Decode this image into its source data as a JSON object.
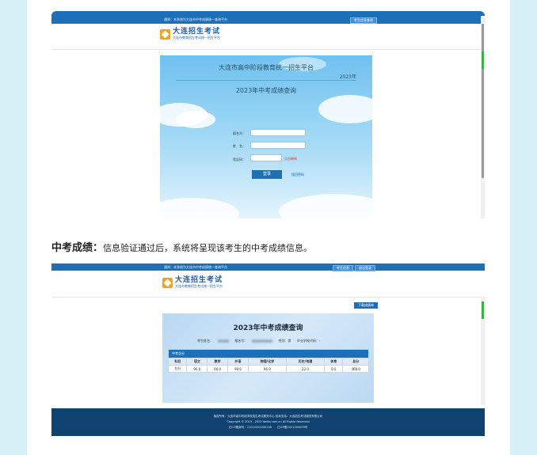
{
  "shot1": {
    "notice": "通知：本系统为大连市中考成绩统一查询平台",
    "top_button": "考生信息查询",
    "logo_title": "大连招生考试",
    "logo_subtitle": "大连市教育招生考试统一招生平台",
    "platform_title": "大连市高中阶段教育统一招生平台",
    "year": "2023年",
    "query_title": "2023年中考成绩查询",
    "form": {
      "exam_no_label": "报名号：",
      "name_label": "姓　名：",
      "captcha_label": "验证码：",
      "captcha_hint": "点击刷新",
      "login_button": "登录",
      "forgot_link": "找回密码"
    }
  },
  "caption": {
    "heading": "中考成绩：",
    "text": "信息验证通过后，系统将呈现该考生的中考成绩信息。"
  },
  "shot2": {
    "notice": "通知：本系统为大连市中考成绩统一查询平台",
    "top_buttons": [
      "考生信息",
      "退出登录"
    ],
    "logo_title": "大连招生考试",
    "logo_subtitle": "大连市教育招生考试统一招生平台",
    "download_button": "下载成绩单",
    "result_title": "2023年中考成绩查询",
    "info": {
      "name_label": "考生姓名：",
      "exam_no_label": "报名号：",
      "gender_label": "性别：男",
      "school_label": "毕业学校代码：-"
    },
    "table": {
      "caption": "中考总分",
      "headers": [
        "科目",
        "语文",
        "数学",
        "外语",
        "物理/化学",
        "道德与法治",
        "历史/地理",
        "体育",
        "总分"
      ],
      "row": [
        "总分",
        "96.0",
        "90.0",
        "98.0",
        "96.0",
        "22.0",
        "0.0",
        "468.0"
      ]
    },
    "footer": [
      "版权所有：大连市高中阶段学校招生考试服务中心 技术支持：大连招生考试服务有限公司",
      "Copyright © 2015 - 2023 lbeiks.com.cn All Rights Reserved",
      "辽ICP备案号：21010202000148　　辽ICP备2021000059号"
    ]
  }
}
